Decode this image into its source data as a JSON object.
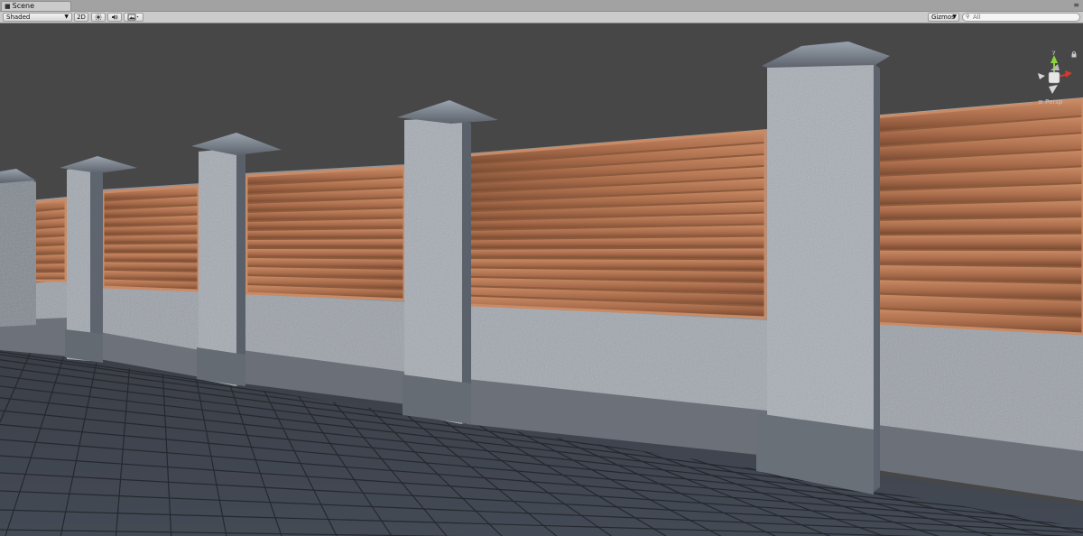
{
  "window": {
    "tab_label": "Scene",
    "tab_icon": "scene-icon",
    "menu_icon": "window-menu-icon"
  },
  "toolbar": {
    "shading_mode": "Shaded",
    "mode_2d_label": "2D",
    "light_toggle_icon": "sun-icon",
    "audio_toggle_icon": "speaker-icon",
    "effects_toggle_icon": "image-effects-icon",
    "gizmos_label": "Gizmos",
    "search_placeholder": "All",
    "search_icon": "search-icon"
  },
  "viewport": {
    "background_color": "#474747",
    "projection_label": "Persp",
    "gizmo": {
      "axis_y_label": "y",
      "axis_y_color": "#8cd23c",
      "axis_x_color": "#d23a2e",
      "axis_z_color": "#3a6fd2",
      "lock_icon": "lock-icon"
    }
  },
  "scene_colors": {
    "floor": "#3c4048",
    "floor_lines": "#24272d",
    "plaster": "#9aa0a8",
    "plaster_shadow": "#7f858e",
    "plinth": "#6f747c",
    "wood": "#b07554",
    "wood_dark": "#7b4a31",
    "cap": "#7a818c"
  }
}
